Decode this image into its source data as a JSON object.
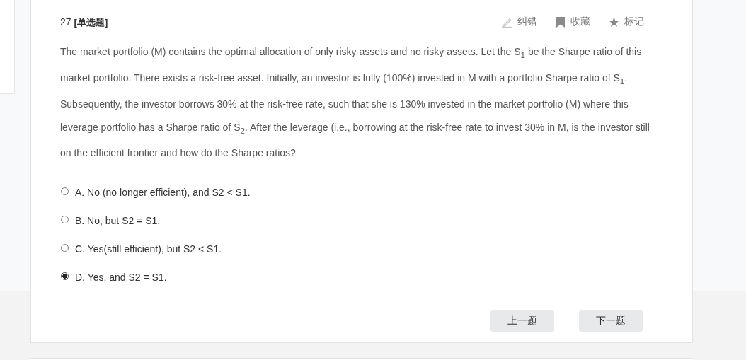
{
  "question": {
    "number": "27",
    "type": "[单选题]",
    "text": "The market portfolio (M) contains the optimal allocation of only risky assets and no risky assets. Let the S$_{1}$ be the Sharpe ratio of this market portfolio. There exists a risk-free asset. Initially, an investor is fully (100%) invested in M with a portfolio Sharpe ratio of S$_{1}$. Subsequently, the investor borrows 30% at the risk-free rate, such that she is 130% invested in the market portfolio (M) where this leverage portfolio has a Sharpe ratio of S$_{2}$. After the leverage (i.e., borrowing at the risk-free rate to invest 30% in M, is the investor still on the efficient frontier and how do the Sharpe ratios?"
  },
  "actions": [
    {
      "kind": "pencil",
      "label": "纠错"
    },
    {
      "kind": "bookmark",
      "label": "收藏"
    },
    {
      "kind": "star",
      "label": "标记"
    }
  ],
  "options": [
    {
      "label": "A. No (no longer efficient), and S2 < S1.",
      "selected": false
    },
    {
      "label": "B. No, but S2 = S1.",
      "selected": false
    },
    {
      "label": "C. Yes(still efficient), but S2 < S1.",
      "selected": false
    },
    {
      "label": "D. Yes, and S2 = S1.",
      "selected": true
    }
  ],
  "buttons": [
    {
      "label": "上一题"
    },
    {
      "label": "下一题"
    }
  ]
}
